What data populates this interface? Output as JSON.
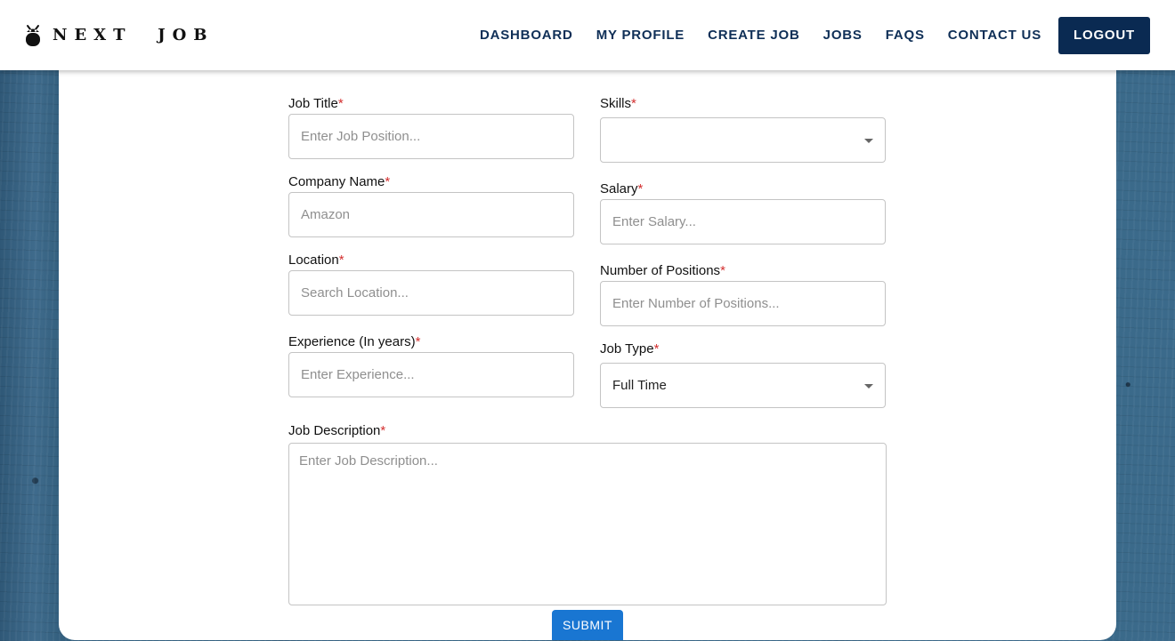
{
  "brand": {
    "name": "NEXT  JOB"
  },
  "nav": {
    "links": [
      "DASHBOARD",
      "MY PROFILE",
      "CREATE JOB",
      "JOBS",
      "FAQS",
      "CONTACT US"
    ],
    "logout": "LOGOUT"
  },
  "form": {
    "required_mark": "*",
    "job_title": {
      "label": "Job Title",
      "placeholder": "Enter Job Position..."
    },
    "company_name": {
      "label": "Company Name",
      "placeholder": "Amazon"
    },
    "location": {
      "label": "Location",
      "placeholder": "Search Location..."
    },
    "experience": {
      "label": "Experience (In years)",
      "placeholder": "Enter Experience..."
    },
    "skills": {
      "label": "Skills",
      "value": ""
    },
    "salary": {
      "label": "Salary",
      "placeholder": "Enter Salary..."
    },
    "positions": {
      "label": "Number of Positions",
      "placeholder": "Enter Number of Positions..."
    },
    "job_type": {
      "label": "Job Type",
      "value": "Full Time"
    },
    "description": {
      "label": "Job Description",
      "placeholder": "Enter Job Description..."
    },
    "submit": "SUBMIT"
  },
  "icons": {
    "logo": "bug-icon",
    "dropdown": "caret-down-icon"
  },
  "colors": {
    "brand_navy": "#0a2a52",
    "nav_text": "#0f2f57",
    "submit_blue": "#1976d2",
    "required_red": "#d32f2f"
  }
}
